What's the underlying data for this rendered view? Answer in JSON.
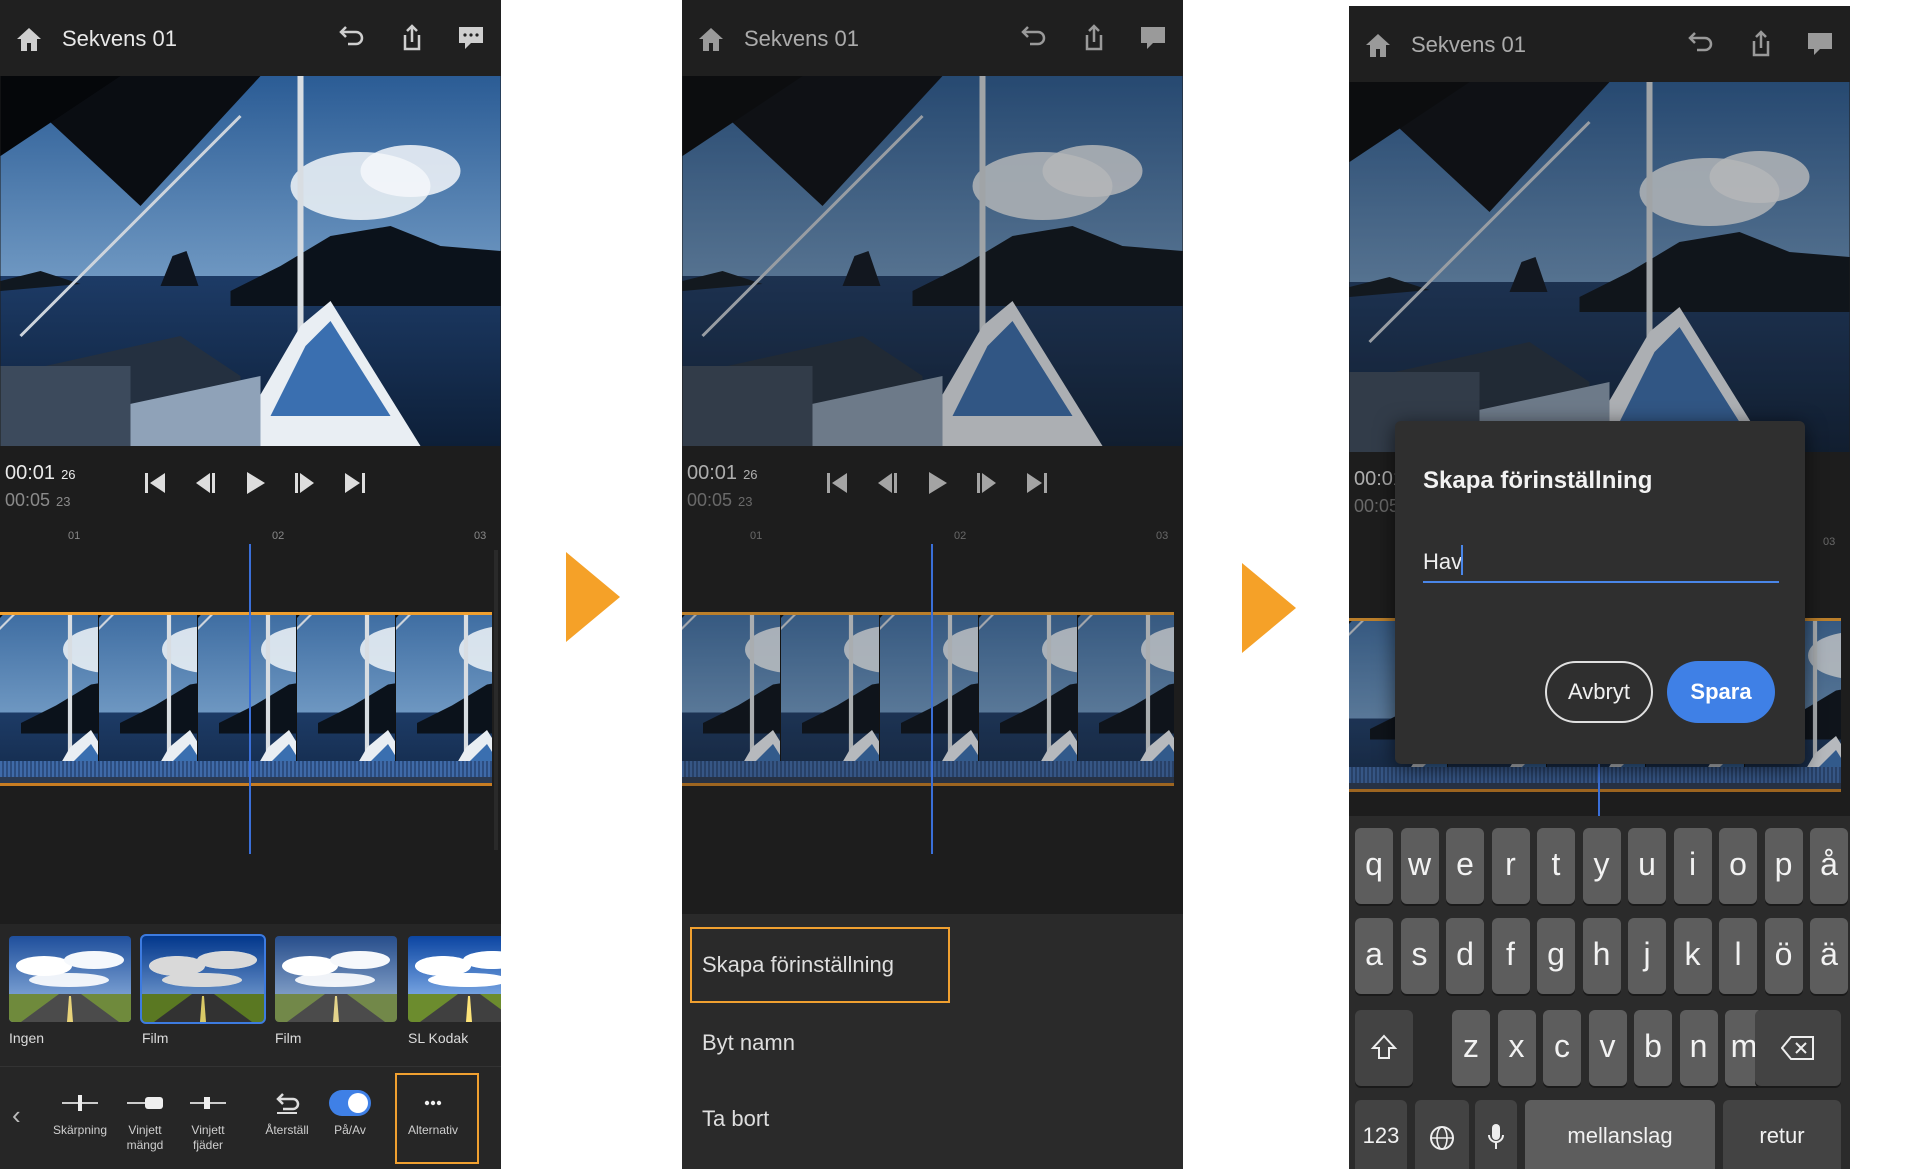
{
  "sequence_title": "Sekvens 01",
  "timecode": {
    "current": "00:01",
    "current_frames": "26",
    "duration": "00:05",
    "duration_frames": "23"
  },
  "ruler_ticks": [
    "01",
    "02",
    "03"
  ],
  "panel1": {
    "presets": [
      {
        "label": "Ingen"
      },
      {
        "label": "Film"
      },
      {
        "label": "Film"
      },
      {
        "label": "SL Kodak"
      }
    ],
    "tools": [
      {
        "label": "Skärpning"
      },
      {
        "label": "Vinjett mängd"
      },
      {
        "label": "Vinjett fjäder"
      },
      {
        "label": "Återställ"
      },
      {
        "label": "På/Av"
      },
      {
        "label": "Alternativ"
      }
    ]
  },
  "panel2": {
    "menu": [
      "Skapa förinställning",
      "Byt namn",
      "Ta bort"
    ]
  },
  "panel3": {
    "dialog_title": "Skapa förinställning",
    "input_value": "Hav",
    "cancel": "Avbryt",
    "save": "Spara",
    "keyboard": {
      "row1": [
        "q",
        "w",
        "e",
        "r",
        "t",
        "y",
        "u",
        "i",
        "o",
        "p",
        "å"
      ],
      "row2": [
        "a",
        "s",
        "d",
        "f",
        "g",
        "h",
        "j",
        "k",
        "l",
        "ö",
        "ä"
      ],
      "row3": [
        "z",
        "x",
        "c",
        "v",
        "b",
        "n",
        "m"
      ],
      "numbers": "123",
      "space": "mellanslag",
      "return": "retur"
    }
  },
  "colors": {
    "accent_orange": "#f5a128",
    "accent_blue": "#3f80e6",
    "bg_dark": "#1d1d1d"
  }
}
